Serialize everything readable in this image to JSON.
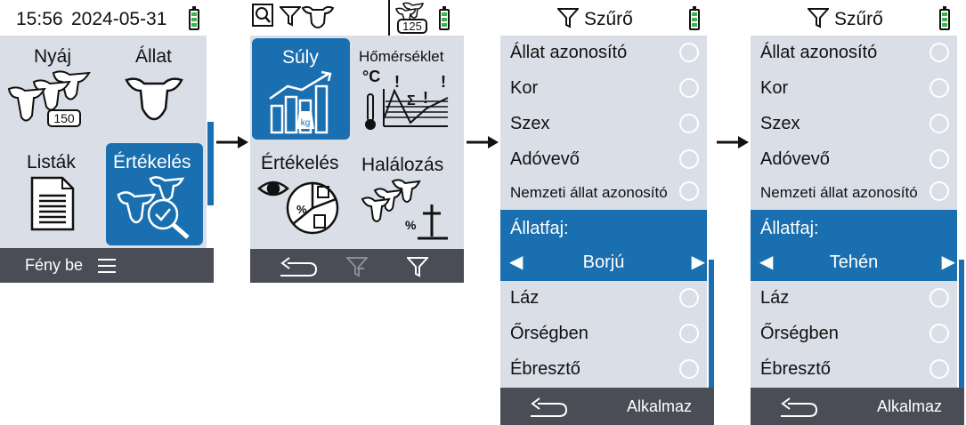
{
  "screen1": {
    "time": "15:56",
    "date": "2024-05-31",
    "tiles": [
      {
        "label": "Nyáj",
        "icon": "herd-icon",
        "badge": "150"
      },
      {
        "label": "Állat",
        "icon": "cow-head-icon"
      },
      {
        "label": "Listák",
        "icon": "list-document-icon"
      },
      {
        "label": "Értékelés",
        "icon": "evaluation-herd-icon",
        "selected": true
      }
    ],
    "bottom": {
      "light_label": "Fény be",
      "menu_icon": "menu-icon"
    }
  },
  "screen2": {
    "status_badge": "125",
    "tiles": [
      {
        "label": "Súly",
        "icon": "weight-chart-icon",
        "selected": true
      },
      {
        "label": "Hőmérséklet",
        "icon": "temperature-chart-icon",
        "unit": "°C"
      },
      {
        "label": "Értékelés",
        "icon": "evaluation-pie-icon"
      },
      {
        "label": "Halálozás",
        "icon": "mortality-icon"
      }
    ]
  },
  "screen3": {
    "title": "Szűrő",
    "items_top": [
      "Állat azonosító",
      "Kor",
      "Szex",
      "Adóvevő",
      "Nemzeti állat azonosító"
    ],
    "species_label": "Állatfaj:",
    "species_value": "Borjú",
    "items_bottom": [
      "Láz",
      "Őrségben",
      "Ébresztő"
    ],
    "apply_label": "Alkalmaz"
  },
  "screen4": {
    "title": "Szűrő",
    "items_top": [
      "Állat azonosító",
      "Kor",
      "Szex",
      "Adóvevő",
      "Nemzeti állat azonosító"
    ],
    "species_label": "Állatfaj:",
    "species_value": "Tehén",
    "items_bottom": [
      "Láz",
      "Őrségben",
      "Ébresztő"
    ],
    "apply_label": "Alkalmaz"
  },
  "colors": {
    "accent": "#1a6fb0",
    "screen_bg": "#d9dee7",
    "bottom_bar": "#4a4d55",
    "battery": "#39b54a"
  }
}
